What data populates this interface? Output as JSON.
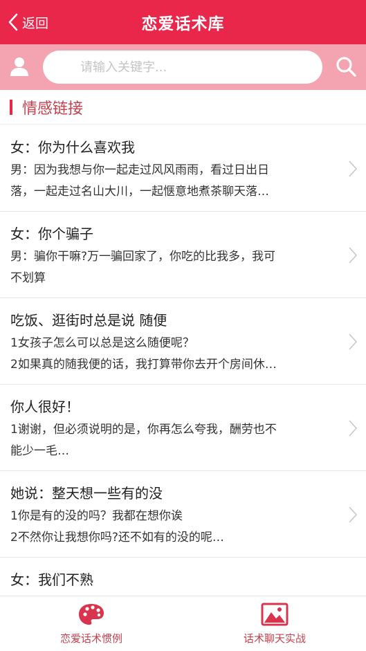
{
  "header": {
    "back_label": "返回",
    "title": "恋爱话术库"
  },
  "search": {
    "placeholder": "请输入关键字..."
  },
  "section": {
    "title": "情感链接"
  },
  "items": [
    {
      "title": "女：你为什么喜欢我",
      "line1": "男：因为我想与你一起走过风风雨雨，看过日出日",
      "line2": "落，一起走过名山大川，一起惬意地煮茶聊天落…"
    },
    {
      "title": "女：你个骗子",
      "line1": "男：骗你干嘛?万一骗回家了，你吃的比我多，我可",
      "line2": "不划算"
    },
    {
      "title": "吃饭、逛街时总是说 随便",
      "line1": "1女孩子怎么可以总是这么随便呢？",
      "line2": "2如果真的随我便的话，我打算带你去开个房间休…"
    },
    {
      "title": "你人很好！",
      "line1": "1谢谢，但必须说明的是，你再怎么夸我，酬劳也不",
      "line2": "能少一毛…"
    },
    {
      "title": "她说：整天想一些有的没",
      "line1": "1你是有的没的吗？我都在想你诶",
      "line2": "2不然你让我想你吗?还不如有的没的呢…"
    },
    {
      "title": "女：我们不熟",
      "line1": "",
      "line2": ""
    }
  ],
  "tabs": [
    {
      "label": "恋爱话术惯例",
      "icon": "palette-icon"
    },
    {
      "label": "话术聊天实战",
      "icon": "image-icon"
    }
  ],
  "colors": {
    "header_bg": "#e8274a",
    "search_bg": "#f4a4b0",
    "accent": "#c8404e"
  }
}
